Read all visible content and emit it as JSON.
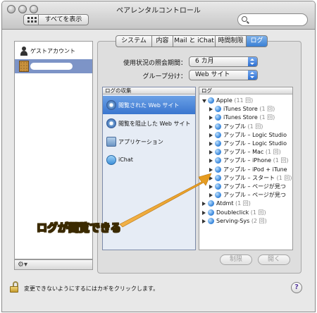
{
  "window": {
    "title": "ペアレンタルコントロール"
  },
  "toolbar": {
    "show_all_label": "すべてを表示",
    "search_placeholder": ""
  },
  "users": [
    {
      "name": "ゲストアカウント",
      "selected": false
    },
    {
      "name": "",
      "selected": true
    }
  ],
  "tabs": [
    {
      "label": "システム",
      "active": false
    },
    {
      "label": "内容",
      "active": false
    },
    {
      "label": "Mail と iChat",
      "active": false
    },
    {
      "label": "時間制限",
      "active": false
    },
    {
      "label": "ログ",
      "active": true
    }
  ],
  "filters": {
    "period_label": "使用状況の照会期間：",
    "period_value": "6 カ月",
    "group_label": "グループ分け：",
    "group_value": "Web サイト"
  },
  "log_sources": {
    "header": "ログの収集",
    "items": [
      {
        "label": "閲覧された Web サイト",
        "icon": "safari-icon",
        "selected": true
      },
      {
        "label": "閲覧を阻止した Web サイト",
        "icon": "safari-icon",
        "selected": false
      },
      {
        "label": "アプリケーション",
        "icon": "applications-folder-icon",
        "selected": false
      },
      {
        "label": "iChat",
        "icon": "ichat-icon",
        "selected": false
      }
    ]
  },
  "log": {
    "header": "ログ",
    "rows": [
      {
        "label": "Apple",
        "count": "(11 回)",
        "level": 0,
        "expanded": true
      },
      {
        "label": "iTunes Store",
        "count": "(1 回)",
        "level": 1,
        "expanded": false
      },
      {
        "label": "iTunes Store",
        "count": "(1 回)",
        "level": 1,
        "expanded": false
      },
      {
        "label": "アップル",
        "count": "(1 回)",
        "level": 1,
        "expanded": false
      },
      {
        "label": "アップル – Logic Studio",
        "count": "",
        "level": 1,
        "expanded": false
      },
      {
        "label": "アップル – Logic Studio",
        "count": "",
        "level": 1,
        "expanded": false
      },
      {
        "label": "アップル – Mac",
        "count": "(1 回)",
        "level": 1,
        "expanded": false
      },
      {
        "label": "アップル – iPhone",
        "count": "(1 回)",
        "level": 1,
        "expanded": false
      },
      {
        "label": "アップル – iPod + iTune",
        "count": "",
        "level": 1,
        "expanded": false
      },
      {
        "label": "アップル – スタート",
        "count": "(1 回)",
        "level": 1,
        "expanded": false
      },
      {
        "label": "アップル – ページが見つ",
        "count": "",
        "level": 1,
        "expanded": false
      },
      {
        "label": "アップル – ページが見つ",
        "count": "",
        "level": 1,
        "expanded": false
      },
      {
        "label": "Atdmt",
        "count": "(1 回)",
        "level": 0,
        "expanded": false
      },
      {
        "label": "Doubleclick",
        "count": "(1 回)",
        "level": 0,
        "expanded": false
      },
      {
        "label": "Serving-Sys",
        "count": "(2 回)",
        "level": 0,
        "expanded": false
      }
    ]
  },
  "buttons": {
    "restrict_label": "制限",
    "open_label": "開く"
  },
  "footer": {
    "lock_text": "変更できないようにするにはカギをクリックします。",
    "help_label": "?"
  },
  "annotation": {
    "text": "ログが閲覧できる",
    "color": "#f0a020"
  }
}
